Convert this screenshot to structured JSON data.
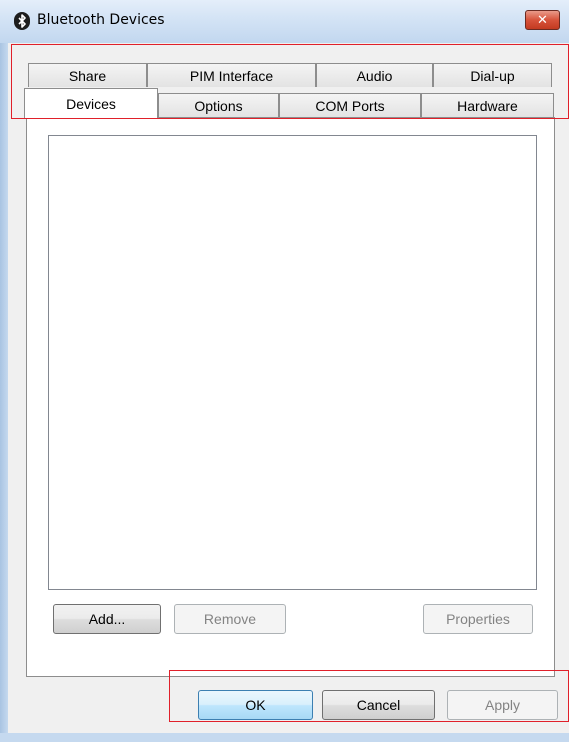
{
  "window": {
    "title": "Bluetooth Devices",
    "close_glyph": "✕"
  },
  "tabs": {
    "row_back": [
      {
        "label": "Share"
      },
      {
        "label": "PIM Interface"
      },
      {
        "label": "Audio"
      },
      {
        "label": "Dial-up"
      }
    ],
    "row_front": [
      {
        "label": "Devices",
        "selected": true
      },
      {
        "label": "Options"
      },
      {
        "label": "COM Ports"
      },
      {
        "label": "Hardware"
      }
    ]
  },
  "devices_panel": {
    "buttons": {
      "add": "Add...",
      "remove": "Remove",
      "properties": "Properties"
    }
  },
  "dialog_buttons": {
    "ok": "OK",
    "cancel": "Cancel",
    "apply": "Apply"
  },
  "colors": {
    "highlight": "#e0202a",
    "title_bar": "#d3e3f5",
    "close_button": "#d7533b"
  },
  "icons": {
    "title": "bluetooth-icon",
    "close": "close-icon"
  }
}
